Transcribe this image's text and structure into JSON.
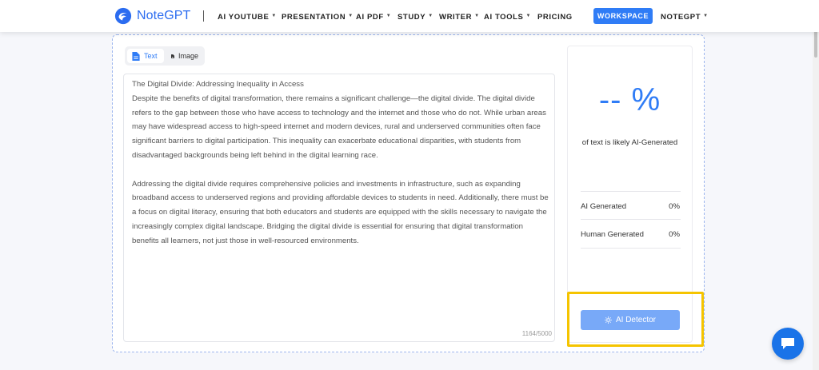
{
  "nav": {
    "brand": "NoteGPT",
    "items": [
      {
        "label": "AI YOUTUBE",
        "caret": "▼"
      },
      {
        "label": "PRESENTATION",
        "caret": "▼"
      },
      {
        "label": "AI PDF",
        "caret": "▼"
      },
      {
        "label": "STUDY",
        "caret": "▼"
      },
      {
        "label": "WRITER",
        "caret": "▼"
      },
      {
        "label": "AI TOOLS",
        "caret": "▼"
      },
      {
        "label": "PRICING",
        "caret": ""
      }
    ],
    "workspace": "WORKSPACE",
    "account": {
      "label": "NOTEGPT",
      "caret": "▼"
    }
  },
  "tabs": {
    "text": {
      "label": "Text",
      "icon": "document-icon"
    },
    "image": {
      "label": "Image",
      "icon": "image-file-icon"
    },
    "active": "text"
  },
  "editor": {
    "title": "The Digital Divide: Addressing Inequality in Access",
    "paragraph1": "Despite the benefits of digital transformation, there remains a significant challenge—the digital divide. The digital divide refers to the gap between those who have access to technology and the internet and those who do not. While urban areas may have widespread access to high-speed internet and modern devices, rural and underserved communities often face significant barriers to digital participation. This inequality can exacerbate educational disparities, with students from disadvantaged backgrounds being left behind in the digital learning race.",
    "paragraph2": "Addressing the digital divide requires comprehensive policies and investments in infrastructure, such as expanding broadband access to underserved regions and providing affordable devices to students in need. Additionally, there must be a focus on digital literacy, ensuring that both educators and students are equipped with the skills necessary to navigate the increasingly complex digital landscape. Bridging the digital divide is essential for ensuring that digital transformation benefits all learners, not just those in well-resourced environments.",
    "char_count": "1164/5000"
  },
  "result": {
    "percentage": "-- %",
    "caption": "of text is likely AI-Generated",
    "ai_generated": {
      "label": "AI Generated",
      "value": "0%"
    },
    "human_generated": {
      "label": "Human Generated",
      "value": "0%"
    },
    "button": "AI Detector"
  },
  "colors": {
    "brand_blue": "#2f7cf6",
    "button_disabled": "#78a9f8",
    "highlight": "#f5c400",
    "chat": "#1a73e8"
  }
}
